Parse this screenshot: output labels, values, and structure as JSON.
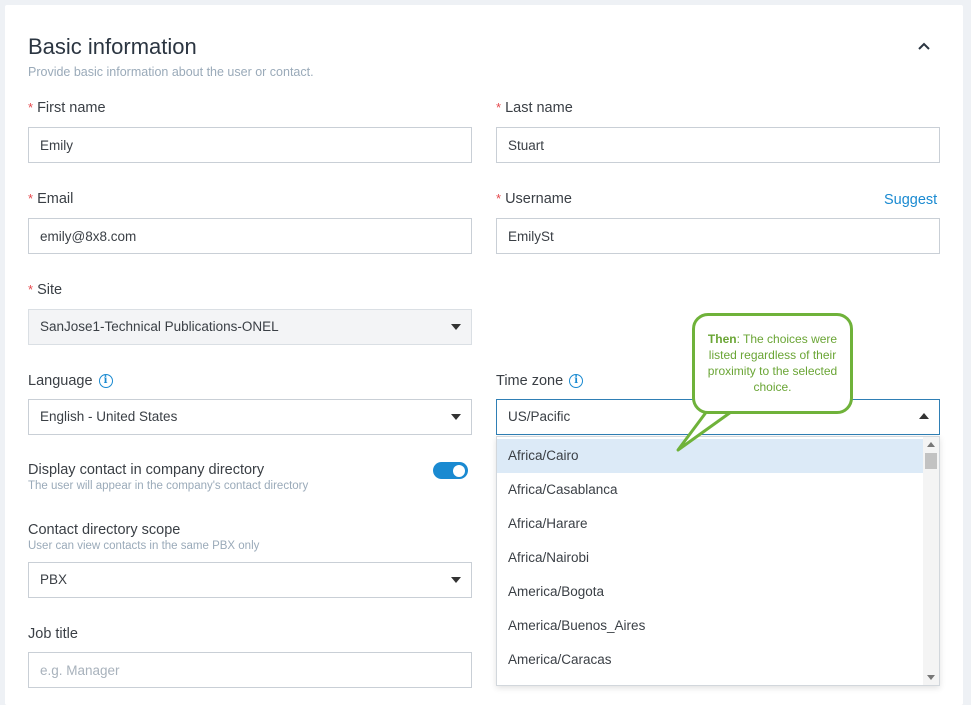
{
  "section": {
    "title": "Basic information",
    "subtitle": "Provide basic information about the user or contact."
  },
  "required_marker": "*",
  "fields": {
    "first_name": {
      "label": "First name",
      "value": "Emily"
    },
    "last_name": {
      "label": "Last name",
      "value": "Stuart"
    },
    "email": {
      "label": "Email",
      "value": "emily@8x8.com"
    },
    "username": {
      "label": "Username",
      "value": "EmilySt",
      "suggest_label": "Suggest"
    },
    "site": {
      "label": "Site",
      "value": "SanJose1-Technical Publications-ONEL"
    },
    "language": {
      "label": "Language",
      "value": "English - United States"
    },
    "time_zone": {
      "label": "Time zone",
      "value": "US/Pacific",
      "options": [
        "Africa/Cairo",
        "Africa/Casablanca",
        "Africa/Harare",
        "Africa/Nairobi",
        "America/Bogota",
        "America/Buenos_Aires",
        "America/Caracas"
      ],
      "highlighted_index": 0
    },
    "display_contact": {
      "label": "Display contact in company directory",
      "hint": "The user will appear in the company's contact directory",
      "enabled": true
    },
    "contact_scope": {
      "label": "Contact directory scope",
      "hint": "User can view contacts in the same PBX only",
      "value": "PBX"
    },
    "job_title": {
      "label": "Job title",
      "placeholder": "e.g. Manager",
      "value": ""
    }
  },
  "info_icon_glyph": "i",
  "callout": {
    "lead": "Then",
    "text": ": The choices were listed regardless of their proximity to the selected choice."
  },
  "colors": {
    "accent": "#1a8ad1",
    "required": "#e5484d",
    "callout": "#6fb23a",
    "highlight": "#dceaf7"
  },
  "icons": {
    "collapse": "chevron-up-icon",
    "info": "info-icon",
    "dropdown": "caret-down-icon"
  }
}
